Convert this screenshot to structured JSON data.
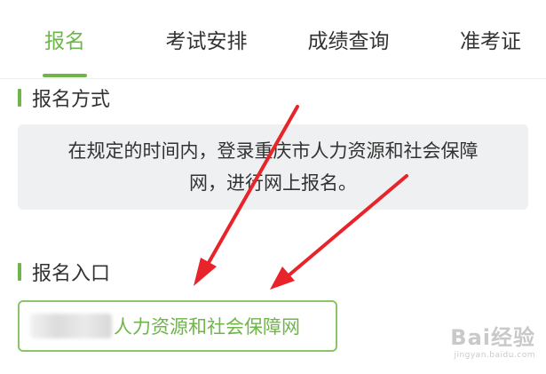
{
  "tabs": [
    {
      "label": "报名",
      "active": true
    },
    {
      "label": "考试安排",
      "active": false
    },
    {
      "label": "成绩查询",
      "active": false
    },
    {
      "label": "准考证",
      "active": false
    }
  ],
  "sections": {
    "method": {
      "title": "报名方式",
      "text_line1": "在规定的时间内，登录重庆市人力资源和社会保障",
      "text_line2": "网，进行网上报名。"
    },
    "entry": {
      "title": "报名入口",
      "button_label": "人力资源和社会保障网"
    }
  },
  "watermark": {
    "brand": "Bai经验",
    "url": "jingyan.baidu.com"
  },
  "colors": {
    "accent": "#6fb54a",
    "arrow": "#e8232a",
    "box_bg": "#eff0f2"
  }
}
